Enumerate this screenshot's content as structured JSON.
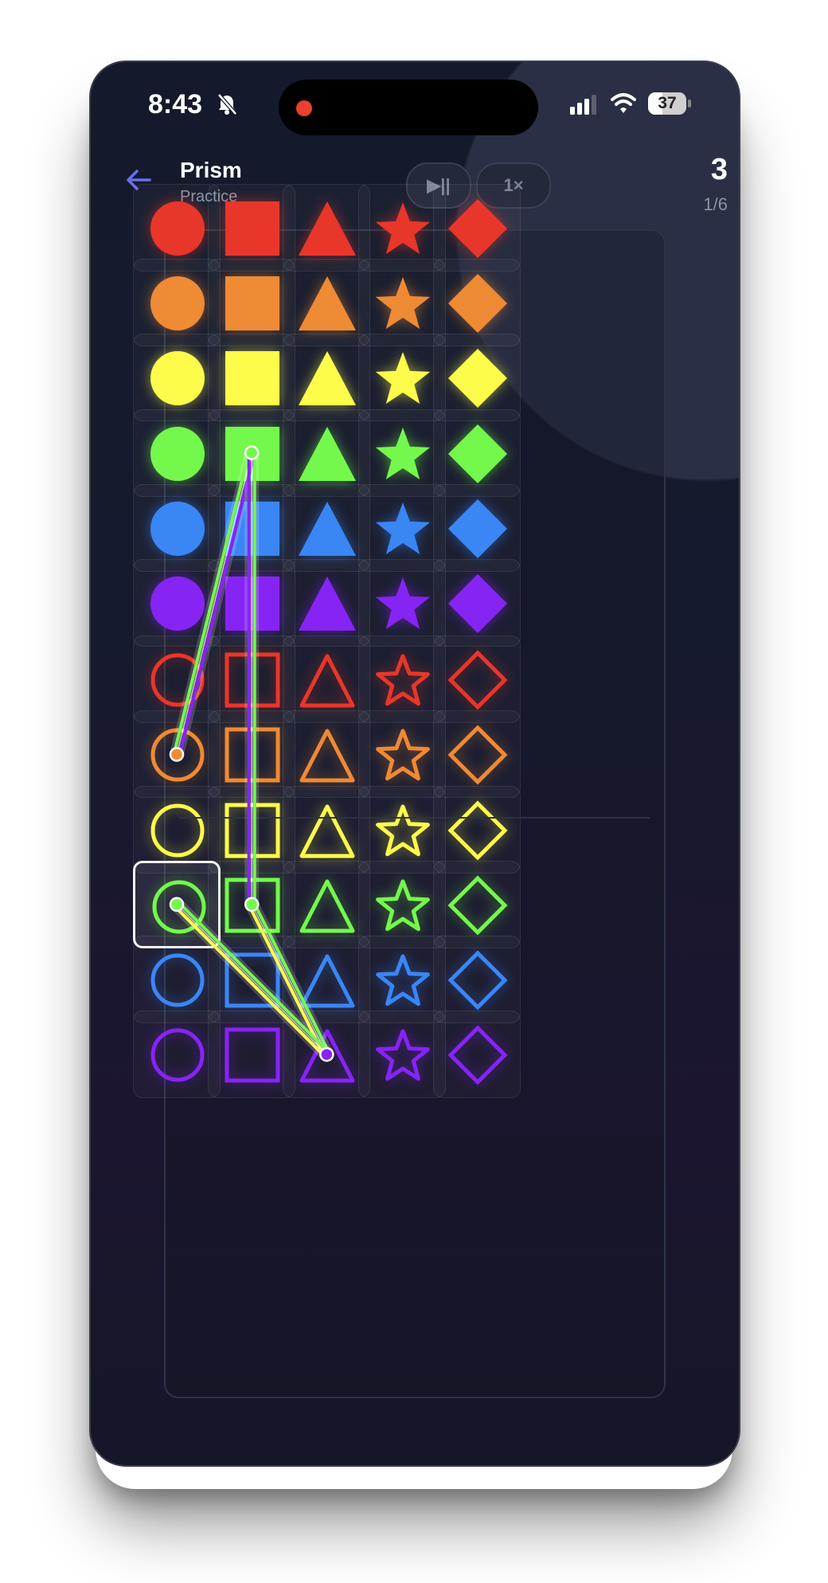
{
  "status_bar": {
    "time": "8:43",
    "battery": "37",
    "battery_level": 0.37
  },
  "header": {
    "back_icon": "arrow-left-icon",
    "title": "Prism",
    "subtitle": "Practice",
    "play_pause_label": "▶||",
    "speed_label": "1×",
    "score": "3",
    "progress": "1/6"
  },
  "colors": {
    "red": "#e8362a",
    "orange": "#ef8a35",
    "yellow": "#fdfc4a",
    "green": "#74f84c",
    "blue": "#3a86f5",
    "purple": "#8624f4",
    "accent": "#6a6ef0"
  },
  "grid": {
    "shapes": [
      "circle",
      "square",
      "triangle",
      "star",
      "diamond"
    ],
    "filled_rows": [
      "red",
      "orange",
      "yellow",
      "green",
      "blue",
      "purple"
    ],
    "outline_rows": [
      "red",
      "orange",
      "yellow",
      "green",
      "blue",
      "purple"
    ],
    "selected_cell": {
      "row": 9,
      "col": 0
    }
  },
  "paths": [
    {
      "from": {
        "row": 7,
        "col": 0
      },
      "to": {
        "row": 3,
        "col": 1
      },
      "colors": [
        "green",
        "purple"
      ]
    },
    {
      "from": {
        "row": 3,
        "col": 1
      },
      "to": {
        "row": 9,
        "col": 1
      },
      "colors": [
        "green",
        "purple"
      ]
    },
    {
      "from": {
        "row": 9,
        "col": 1
      },
      "to": {
        "row": 11,
        "col": 2
      },
      "colors": [
        "green",
        "yellow"
      ]
    },
    {
      "from": {
        "row": 9,
        "col": 0
      },
      "to": {
        "row": 11,
        "col": 2
      },
      "colors": [
        "green",
        "yellow"
      ]
    }
  ],
  "path_nodes": [
    {
      "row": 7,
      "col": 0,
      "color": "orange"
    },
    {
      "row": 3,
      "col": 1,
      "color": "green"
    },
    {
      "row": 9,
      "col": 1,
      "color": "green"
    },
    {
      "row": 9,
      "col": 0,
      "color": "green"
    },
    {
      "row": 11,
      "col": 2,
      "color": "purple"
    }
  ]
}
